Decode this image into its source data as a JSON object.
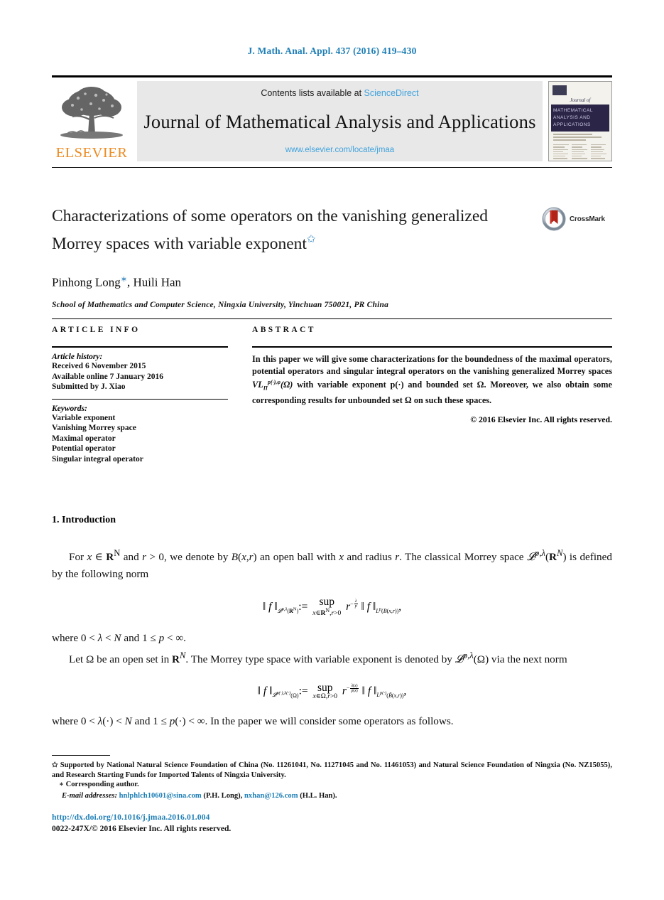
{
  "running_head": "J. Math. Anal. Appl. 437 (2016) 419–430",
  "masthead": {
    "contents_prefix": "Contents lists available at ",
    "contents_link": "ScienceDirect",
    "journal_title": "Journal of Mathematical Analysis and Applications",
    "journal_url": "www.elsevier.com/locate/jmaa",
    "publisher": "ELSEVIER",
    "cover": {
      "journal_of": "Journal of",
      "band_line1": "MATHEMATICAL",
      "band_line2": "ANALYSIS AND",
      "band_line3": "APPLICATIONS"
    }
  },
  "article": {
    "title_line1": "Characterizations of some operators on the vanishing generalized",
    "title_line2": "Morrey spaces with variable exponent",
    "title_footnote_mark": "✩",
    "crossmark_label": "CrossMark",
    "authors": "Pinhong Long",
    "authors_mark": "∗",
    "authors_rest": ", Huili Han",
    "affiliation": "School of Mathematics and Computer Science, Ningxia University, Yinchuan 750021, PR China"
  },
  "info": {
    "heading": "ARTICLE INFO",
    "history_head": "Article history:",
    "history": [
      "Received 6 November 2015",
      "Available online 7 January 2016",
      "Submitted by J. Xiao"
    ],
    "keywords_head": "Keywords:",
    "keywords": [
      "Variable exponent",
      "Vanishing Morrey space",
      "Maximal operator",
      "Potential operator",
      "Singular integral operator"
    ]
  },
  "abstract": {
    "heading": "ABSTRACT",
    "text_part1": "In this paper we will give some characterizations for the boundedness of the maximal operators, potential operators and singular integral operators on the vanishing generalized Morrey spaces ",
    "math_inline": "VL_Π^{p(·),φ}(Ω)",
    "text_part2": " with variable exponent p(·) and bounded set Ω. Moreover, we also obtain some corresponding results for unbounded set Ω on such these spaces.",
    "copyright": "© 2016 Elsevier Inc. All rights reserved."
  },
  "body": {
    "section_title": "1. Introduction",
    "para1": "For x ∈ R^N and r > 0, we denote by B(x,r) an open ball with x and radius r. The classical Morrey space L^{p,λ}(R^N) is defined by the following norm",
    "equation1": "‖ f ‖_{L^{p,λ}(R^N)} := sup_{x∈R^N, r>0} r^{−λ/p} ‖ f ‖_{L^p(B(x,r))},",
    "para2": "where 0 < λ < N and 1 ≤ p < ∞.",
    "para3": "Let Ω be an open set in R^N. The Morrey type space with variable exponent is denoted by L^{p,λ}(Ω) via the next norm",
    "equation2": "‖ f ‖_{L^{p(·),λ(·)}(Ω)} := sup_{x∈Ω, r>0} r^{−λ(x)/p(x)} ‖ f ‖_{L^{p(·)}(B̃(x,r))},",
    "para4": "where 0 < λ(·) < N and 1 ≤ p(·) < ∞. In the paper we will consider some operators as follows."
  },
  "footnotes": {
    "funding_mark": "✩",
    "funding": "Supported by National Natural Science Foundation of China (No. 11261041, No. 11271045 and No. 11461053) and Natural Science Foundation of Ningxia (No. NZ15055), and Research Starting Funds for Imported Talents of Ningxia University.",
    "corresponding_mark": "∗",
    "corresponding": "Corresponding author.",
    "email_label": "E-mail addresses:",
    "email1": "hnlphlch10601@sina.com",
    "email1_owner": "(P.H. Long),",
    "email2": "nxhan@126.com",
    "email2_owner": "(H.L. Han)."
  },
  "footer": {
    "doi": "http://dx.doi.org/10.1016/j.jmaa.2016.01.004",
    "issn": "0022-247X/© 2016 Elsevier Inc. All rights reserved."
  },
  "colors": {
    "link_blue": "#1f7fb6",
    "sciencedirect_blue": "#3ea2dd",
    "elsevier_orange": "#ec8b22",
    "crossmark_red": "#b32317"
  }
}
